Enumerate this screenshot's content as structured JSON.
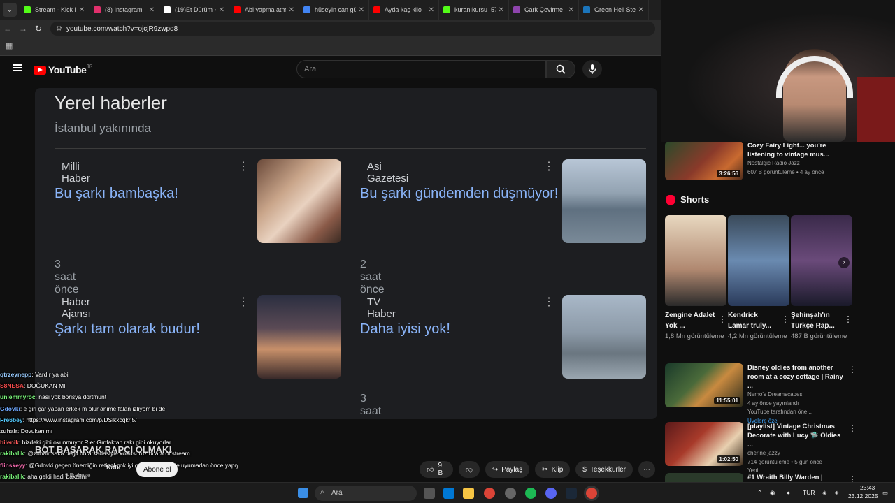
{
  "browser": {
    "tabs": [
      {
        "label": "Stream - Kick D",
        "color": "#53fc18"
      },
      {
        "label": "(8) Instagram",
        "color": "#e1306c"
      },
      {
        "label": "(19)Et Dürüm k",
        "color": "#ffffff"
      },
      {
        "label": "Abi yapma atm",
        "color": "#ff0000"
      },
      {
        "label": "hüseyin can gü",
        "color": "#4285f4"
      },
      {
        "label": "Ayda kaç kilo",
        "color": "#ff0000"
      },
      {
        "label": "kuranıkursu_57",
        "color": "#53fc18"
      },
      {
        "label": "Çark Çevirme",
        "color": "#8e44ad"
      },
      {
        "label": "Green Hell Ste",
        "color": "#1b75bb"
      }
    ],
    "url": "youtube.com/watch?v=ojcjR9zwpd8"
  },
  "youtube": {
    "logo_text": "YouTube",
    "region": "TR",
    "search_placeholder": "Ara"
  },
  "video": {
    "title": "Yerel haberler",
    "subtitle": "İstanbul yakınında",
    "cards": [
      {
        "source": "Milli Haber",
        "headline": "Bu şarkı bambaşka!",
        "time": "3 saat önce"
      },
      {
        "source": "Asi Gazetesi",
        "headline": "Bu şarkı gündemden düşmüyor!",
        "time": "2 saat önce"
      },
      {
        "source": "Haber Ajansı",
        "headline": "Şarkı tam olarak budur!",
        "time": "3 saat önce"
      },
      {
        "source": "TV Haber",
        "headline": "Daha iyisi yok!",
        "time": "3 saat önce"
      }
    ]
  },
  "chat": [
    {
      "user": "qtrzeynepp",
      "color": "#9cf",
      "msg": ": Vardır ya abi"
    },
    {
      "user": "S8NESA",
      "color": "#ff4d4d",
      "msg": ": DOĞUKAN MI"
    },
    {
      "user": "unlemmyroc",
      "color": "#7fff7f",
      "msg": ": nasi yok borisya dortmunt"
    },
    {
      "user": "Gdovki",
      "color": "#6fa8ff",
      "msg": ": e girl çar yapan erkek m olur anime falan izliyom bi de"
    },
    {
      "user": "Fre6bey",
      "color": "#5cf",
      "msg": ": https://www.instagram.com/p/DSikxcqkrj5/"
    },
    {
      "user": "zuhalr",
      "color": "#ccc",
      "msg": ": Dovukan mı"
    },
    {
      "user": "bilenik",
      "color": "#ff5c5c",
      "msg": ": bizdeki gibi okunmuyor Rler Gırtlaktan rakı gibi okuyorlar"
    },
    {
      "user": "rakibalik",
      "color": "#7fff7f",
      "msg": ": @zuhalr saka degil bu arkadaslyle konusuruz bi ara offstream"
    },
    {
      "user": "flinskeyy",
      "color": "#ff6fb5",
      "msg": ": @Gdovki geçen önerdiğin retinol çok iyi gece maskeyi de uyumadan önce yapıyorum sağol"
    },
    {
      "user": "rakibalik",
      "color": "#7fff7f",
      "msg": ": aha geldi hadi bakalim"
    },
    {
      "user": "lr",
      "color": "#ccc",
      "msg": ": yaaa ölüm benle oynama"
    }
  ],
  "overlay": {
    "banner": "BOT BASARAK RAPÇI OLMAK!",
    "subs": "9 B abone"
  },
  "actions": {
    "join": "Katıl",
    "subscribe": "Abone ol",
    "likes": "9 B",
    "share": "Paylaş",
    "clip": "Klip",
    "thanks": "Teşekkürler"
  },
  "sidebar": {
    "top_video": {
      "title": "Cozy Fairy Light... you're listening to vintage mus...",
      "channel": "Nostalgic Radio Jazz",
      "stats": "607 B görüntüleme • 4 ay önce",
      "duration": "3:26:56"
    },
    "shorts_label": "Shorts",
    "shorts": [
      {
        "title": "Zengine Adalet Yok ...",
        "views": "1,8 Mn görüntüleme"
      },
      {
        "title": "Kendrick Lamar truly...",
        "views": "4,2 Mn görüntüleme"
      },
      {
        "title": "Şehinşah'ın Türkçe Rap...",
        "views": "487 B görüntüleme"
      }
    ],
    "videos": [
      {
        "title": "Disney oldies from another room at a cozy cottage | Rainy ...",
        "channel": "Nemo's Dreamscapes",
        "stats": "4 ay önce yayınlandı",
        "extra": "YouTube tarafından öne...",
        "badge": "Üyelere özel",
        "duration": "11:55:01"
      },
      {
        "title": "[playlist] Vintage Christmas Decorate with Lucy 🛸 Oldies ...",
        "channel": "chérine jazzy",
        "stats": "714 görüntüleme • 5 gün önce",
        "extra": "Yeni",
        "badge": "",
        "duration": "1:02:50"
      },
      {
        "title": "#1 Wraith Billy Warden | Getting",
        "channel": "",
        "stats": "",
        "extra": "",
        "badge": "",
        "duration": ""
      }
    ]
  },
  "taskbar": {
    "search": "Ara",
    "lang": "TUR",
    "time": "23:43",
    "date": "23.12.2025"
  }
}
